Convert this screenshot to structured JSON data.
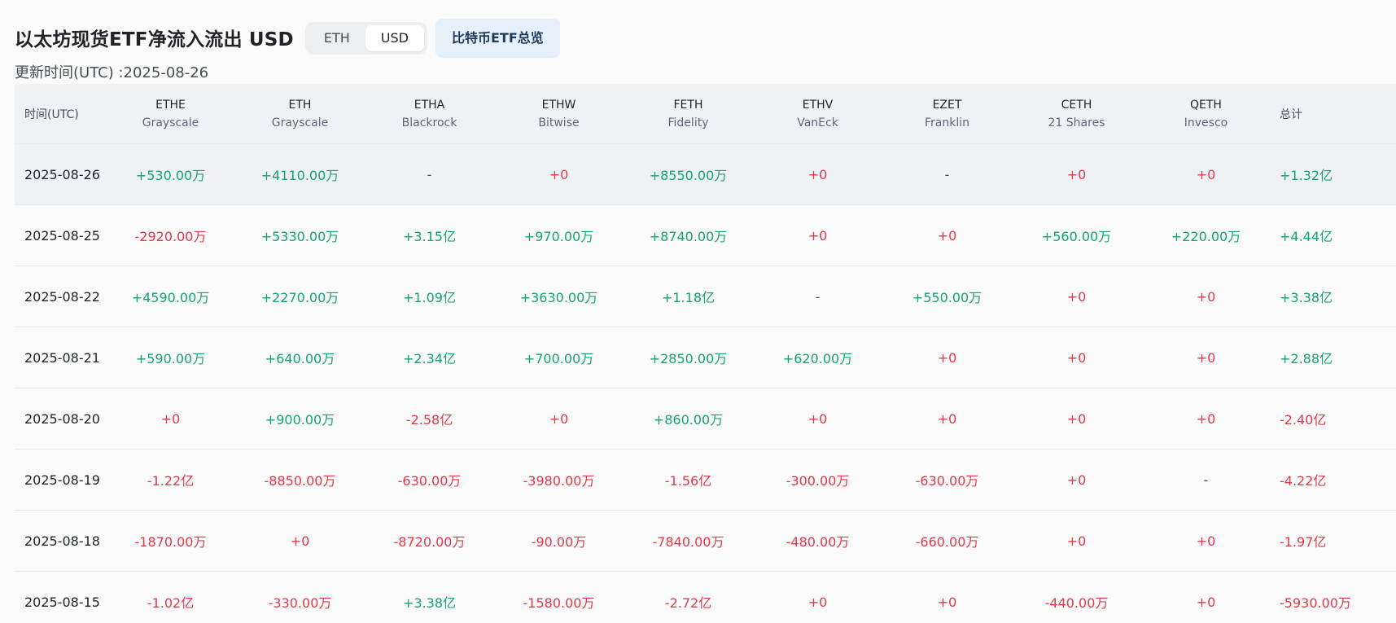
{
  "title": "以太坊现货ETF净流入流出 USD",
  "toggle": {
    "options": [
      "ETH",
      "USD"
    ],
    "selected": "USD"
  },
  "btc_button": "比特币ETF总览",
  "updated": "更新时间(UTC) :2025-08-26",
  "table": {
    "date_header": "时间(UTC)",
    "total_header": "总计",
    "funds": [
      {
        "ticker": "ETHE",
        "issuer": "Grayscale"
      },
      {
        "ticker": "ETH",
        "issuer": "Grayscale"
      },
      {
        "ticker": "ETHA",
        "issuer": "Blackrock"
      },
      {
        "ticker": "ETHW",
        "issuer": "Bitwise"
      },
      {
        "ticker": "FETH",
        "issuer": "Fidelity"
      },
      {
        "ticker": "ETHV",
        "issuer": "VanEck"
      },
      {
        "ticker": "EZET",
        "issuer": "Franklin"
      },
      {
        "ticker": "CETH",
        "issuer": "21 Shares"
      },
      {
        "ticker": "QETH",
        "issuer": "Invesco"
      }
    ],
    "rows": [
      {
        "date": "2025-08-26",
        "values": [
          "+530.00万",
          "+4110.00万",
          "-",
          "+0",
          "+8550.00万",
          "+0",
          "-",
          "+0",
          "+0"
        ],
        "total": "+1.32亿"
      },
      {
        "date": "2025-08-25",
        "values": [
          "-2920.00万",
          "+5330.00万",
          "+3.15亿",
          "+970.00万",
          "+8740.00万",
          "+0",
          "+0",
          "+560.00万",
          "+220.00万"
        ],
        "total": "+4.44亿"
      },
      {
        "date": "2025-08-22",
        "values": [
          "+4590.00万",
          "+2270.00万",
          "+1.09亿",
          "+3630.00万",
          "+1.18亿",
          "-",
          "+550.00万",
          "+0",
          "+0"
        ],
        "total": "+3.38亿"
      },
      {
        "date": "2025-08-21",
        "values": [
          "+590.00万",
          "+640.00万",
          "+2.34亿",
          "+700.00万",
          "+2850.00万",
          "+620.00万",
          "+0",
          "+0",
          "+0"
        ],
        "total": "+2.88亿"
      },
      {
        "date": "2025-08-20",
        "values": [
          "+0",
          "+900.00万",
          "-2.58亿",
          "+0",
          "+860.00万",
          "+0",
          "+0",
          "+0",
          "+0"
        ],
        "total": "-2.40亿"
      },
      {
        "date": "2025-08-19",
        "values": [
          "-1.22亿",
          "-8850.00万",
          "-630.00万",
          "-3980.00万",
          "-1.56亿",
          "-300.00万",
          "-630.00万",
          "+0",
          "-"
        ],
        "total": "-4.22亿"
      },
      {
        "date": "2025-08-18",
        "values": [
          "-1870.00万",
          "+0",
          "-8720.00万",
          "-90.00万",
          "-7840.00万",
          "-480.00万",
          "-660.00万",
          "+0",
          "+0"
        ],
        "total": "-1.97亿"
      },
      {
        "date": "2025-08-15",
        "values": [
          "-1.02亿",
          "-330.00万",
          "+3.38亿",
          "-1580.00万",
          "-2.72亿",
          "+0",
          "+0",
          "-440.00万",
          "+0"
        ],
        "total": "-5930.00万"
      }
    ]
  },
  "colors": {
    "positive": "#16a277",
    "negative": "#e0394a",
    "header_bg": "#eff2f5"
  }
}
